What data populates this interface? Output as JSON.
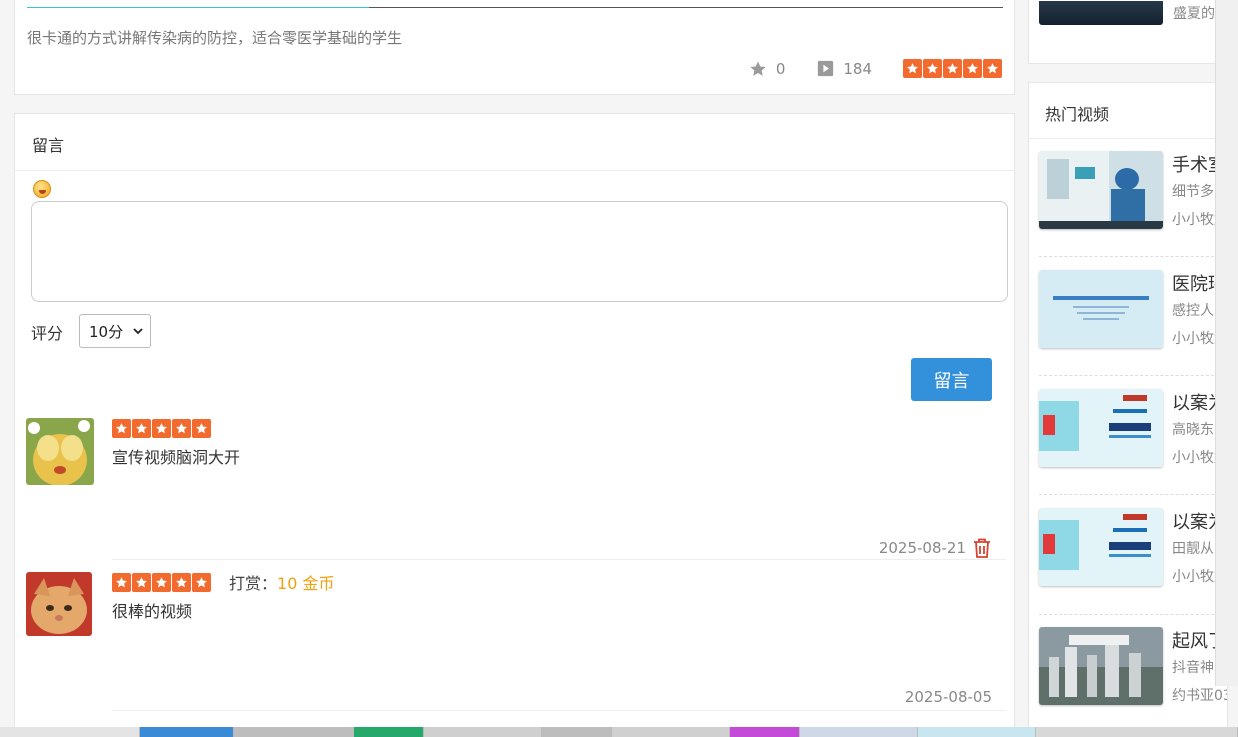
{
  "video": {
    "description": "很卡通的方式讲解传染病的防控，适合零医学基础的学生",
    "favorites": "0",
    "plays": "184",
    "rating_stars": 5,
    "progress_fraction": 0.35
  },
  "comment_form": {
    "title": "留言",
    "input_value": "",
    "rating_label": "评分",
    "rating_selected": "10分",
    "submit_label": "留言"
  },
  "comments": [
    {
      "stars": 5,
      "text": "宣传视频脑洞大开",
      "date": "2025-08-21",
      "deletable": true,
      "reward_label": "",
      "reward_amount": ""
    },
    {
      "stars": 5,
      "text": "很棒的视频",
      "date": "2025-08-05",
      "deletable": false,
      "reward_label": "打赏：",
      "reward_amount": "10 金币"
    }
  ],
  "sidebar": {
    "top_item_text": "盛夏的男",
    "hot_title": "热门视频",
    "hot_items": [
      {
        "title": "手术室",
        "subtitle": "细节多到",
        "author": "小小牧童"
      },
      {
        "title": "医院环",
        "subtitle": "感控人员",
        "author": "小小牧童"
      },
      {
        "title": "以案为",
        "subtitle": "高晓东&",
        "author": "小小牧童"
      },
      {
        "title": "以案为",
        "subtitle": "田靓从了",
        "author": "小小牧童"
      },
      {
        "title": "起风了",
        "subtitle": "抖音神曲",
        "author": "约书亚03"
      }
    ]
  },
  "colors": {
    "star_bg": "#f26a2e",
    "button_blue": "#3391dc",
    "reward_orange": "#f0a010",
    "delete_red": "#d9432f"
  }
}
